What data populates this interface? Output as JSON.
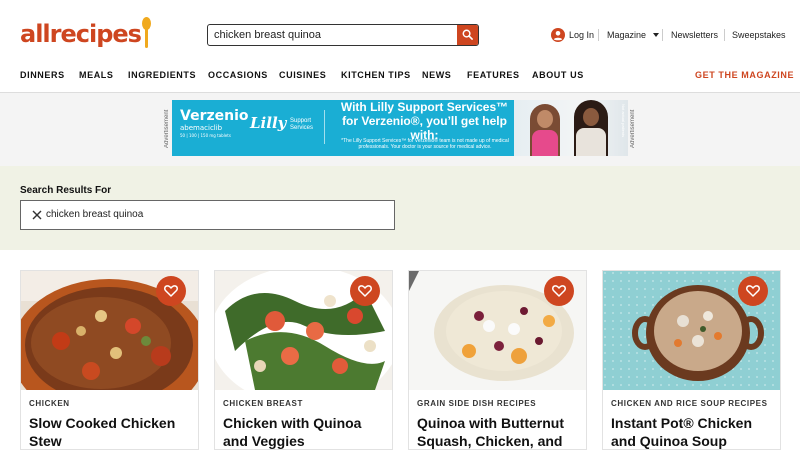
{
  "header": {
    "logo_text": "allrecipes",
    "search_value": "chicken breast quinoa",
    "login_label": "Log In",
    "magazine_label": "Magazine",
    "newsletters_label": "Newsletters",
    "sweepstakes_label": "Sweepstakes",
    "colors": {
      "brand": "#ce4620",
      "accent": "#f0a91e"
    }
  },
  "nav": {
    "items": [
      "DINNERS",
      "MEALS",
      "INGREDIENTS",
      "OCCASIONS",
      "CUISINES",
      "KITCHEN TIPS",
      "NEWS",
      "FEATURES",
      "ABOUT US"
    ],
    "cta": "GET THE MAGAZINE"
  },
  "ad": {
    "label": "Advertisement",
    "brand": "Verzenio",
    "brand_sub": "abemaciclib",
    "brand_fine": "50 | 100 | 150 mg tablets",
    "lilly": "Lilly",
    "support": "Support Services",
    "headline": "With Lilly Support Services™ for Verzenio®, you’ll get help with:",
    "fine": "*The Lilly Support Services™ for Verzenio® team is not made up of medical professionals. Your doctor is your source for medical advice.",
    "side_note": "Not actual patients"
  },
  "results": {
    "label": "Search Results For",
    "query": "chicken breast quinoa"
  },
  "cards": [
    {
      "category": "CHICKEN",
      "title": "Slow Cooked Chicken Stew"
    },
    {
      "category": "CHICKEN BREAST",
      "title": "Chicken with Quinoa and Veggies"
    },
    {
      "category": "GRAIN SIDE DISH RECIPES",
      "title": "Quinoa with Butternut Squash, Chicken, and"
    },
    {
      "category": "CHICKEN AND RICE SOUP RECIPES",
      "title": "Instant Pot® Chicken and Quinoa Soup"
    }
  ]
}
